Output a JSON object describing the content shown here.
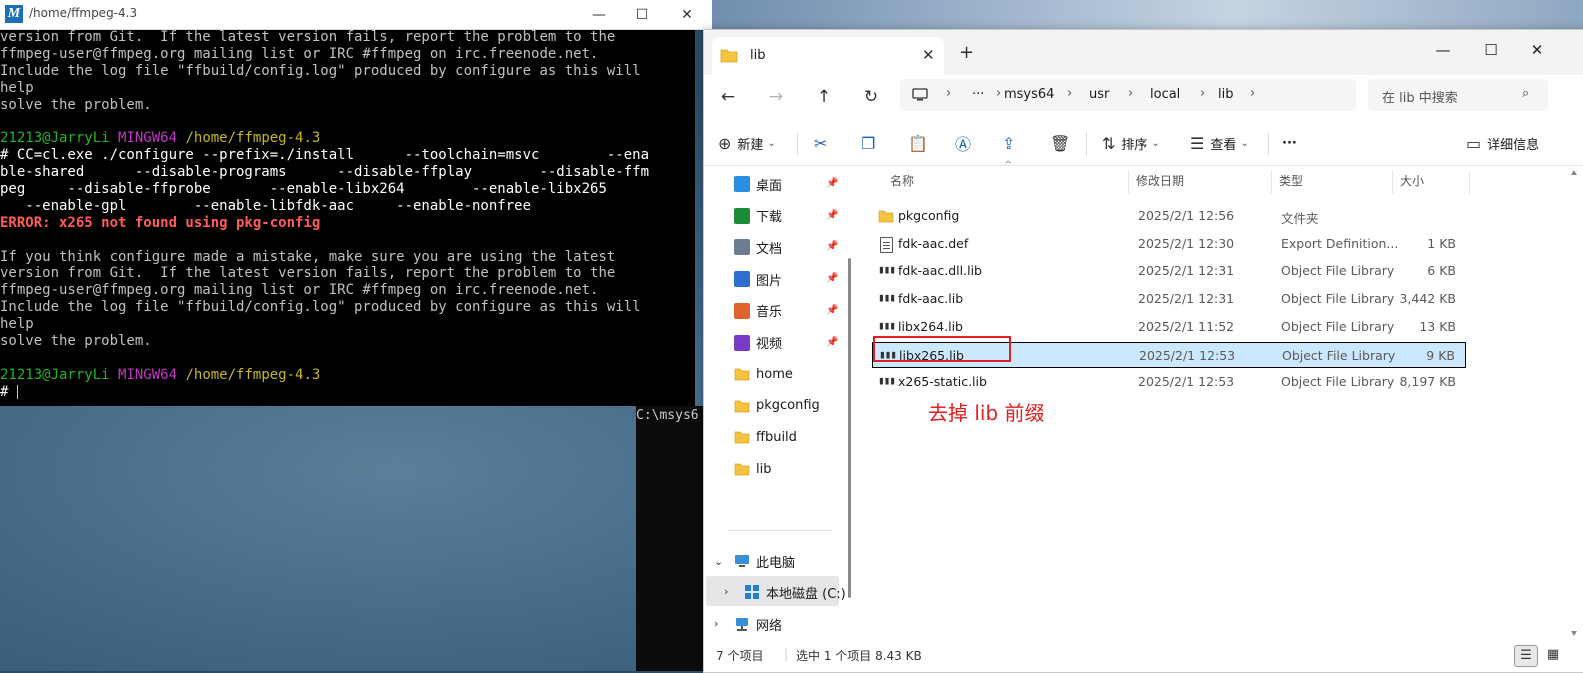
{
  "terminal": {
    "title": "/home/ffmpeg-4.3",
    "lines_before": [
      "version from Git.  If the latest version fails, report the problem to the",
      "ffmpeg-user@ffmpeg.org mailing list or IRC #ffmpeg on irc.freenode.net.",
      "Include the log file \"ffbuild/config.log\" produced by configure as this will",
      "help",
      "solve the problem."
    ],
    "prompt_user": "21213@JarryLi",
    "prompt_env": "MINGW64",
    "prompt_path": "/home/ffmpeg-4.3",
    "command_lines": [
      "# CC=cl.exe ./configure --prefix=./install      --toolchain=msvc        --ena",
      "ble-shared      --disable-programs      --disable-ffplay        --disable-ffm",
      "peg     --disable-ffprobe       --enable-libx264        --enable-libx265",
      "   --enable-gpl        --enable-libfdk-aac     --enable-nonfree"
    ],
    "error_line": "ERROR: x265 not found using pkg-config",
    "lines_after": [
      "If you think configure made a mistake, make sure you are using the latest",
      "version from Git.  If the latest version fails, report the problem to the",
      "ffmpeg-user@ffmpeg.org mailing list or IRC #ffmpeg on irc.freenode.net.",
      "Include the log file \"ffbuild/config.log\" produced by configure as this will",
      "help",
      "solve the problem."
    ],
    "final_prompt": "#"
  },
  "back_cmd": {
    "text": "C:\\msys6"
  },
  "explorer": {
    "tab_title": "lib",
    "breadcrumb": [
      "msys64",
      "usr",
      "local",
      "lib"
    ],
    "breadcrumb_more": "···",
    "search_placeholder": "在 lib 中搜索",
    "commands": {
      "new": "新建",
      "sort": "排序",
      "view": "查看",
      "more": "···",
      "details": "详细信息"
    },
    "nav": {
      "quick": [
        {
          "label": "桌面",
          "icon": "desktop-icon",
          "color": "#2a8ee0"
        },
        {
          "label": "下载",
          "icon": "download-icon",
          "color": "#1d8a3a"
        },
        {
          "label": "文档",
          "icon": "document-icon",
          "color": "#6d7c91"
        },
        {
          "label": "图片",
          "icon": "picture-icon",
          "color": "#2b6fd1"
        },
        {
          "label": "音乐",
          "icon": "music-icon",
          "color": "#e0632e"
        },
        {
          "label": "视频",
          "icon": "video-icon",
          "color": "#7a3cc6"
        }
      ],
      "folders": [
        "home",
        "pkgconfig",
        "ffbuild",
        "lib"
      ],
      "this_pc": "此电脑",
      "local_disk": "本地磁盘 (C:)",
      "network": "网络"
    },
    "columns": {
      "name": "名称",
      "modified": "修改日期",
      "type": "类型",
      "size": "大小"
    },
    "files": [
      {
        "name": "pkgconfig",
        "date": "2025/2/1 12:56",
        "type": "文件夹",
        "size": "",
        "kind": "folder"
      },
      {
        "name": "fdk-aac.def",
        "date": "2025/2/1 12:30",
        "type": "Export Definition...",
        "size": "1 KB",
        "kind": "doc"
      },
      {
        "name": "fdk-aac.dll.lib",
        "date": "2025/2/1 12:31",
        "type": "Object File Library",
        "size": "6 KB",
        "kind": "lib"
      },
      {
        "name": "fdk-aac.lib",
        "date": "2025/2/1 12:31",
        "type": "Object File Library",
        "size": "3,442 KB",
        "kind": "lib"
      },
      {
        "name": "libx264.lib",
        "date": "2025/2/1 11:52",
        "type": "Object File Library",
        "size": "13 KB",
        "kind": "lib"
      },
      {
        "name": "libx265.lib",
        "date": "2025/2/1 12:53",
        "type": "Object File Library",
        "size": "9 KB",
        "kind": "lib",
        "selected": true
      },
      {
        "name": "x265-static.lib",
        "date": "2025/2/1 12:53",
        "type": "Object File Library",
        "size": "8,197 KB",
        "kind": "lib"
      }
    ],
    "annotation": "去掉 lib 前缀",
    "status": {
      "count": "7 个项目",
      "selected": "选中 1 个项目  8.43 KB"
    }
  },
  "colors": {
    "prompt_green": "#24b524",
    "prompt_magenta": "#c237c2",
    "prompt_yellow": "#c8b722",
    "error_red": "#ff5c5c",
    "selection_blue": "#cce8ff",
    "annotation_red": "#e02020",
    "folder_yellow": "#f4c440"
  }
}
